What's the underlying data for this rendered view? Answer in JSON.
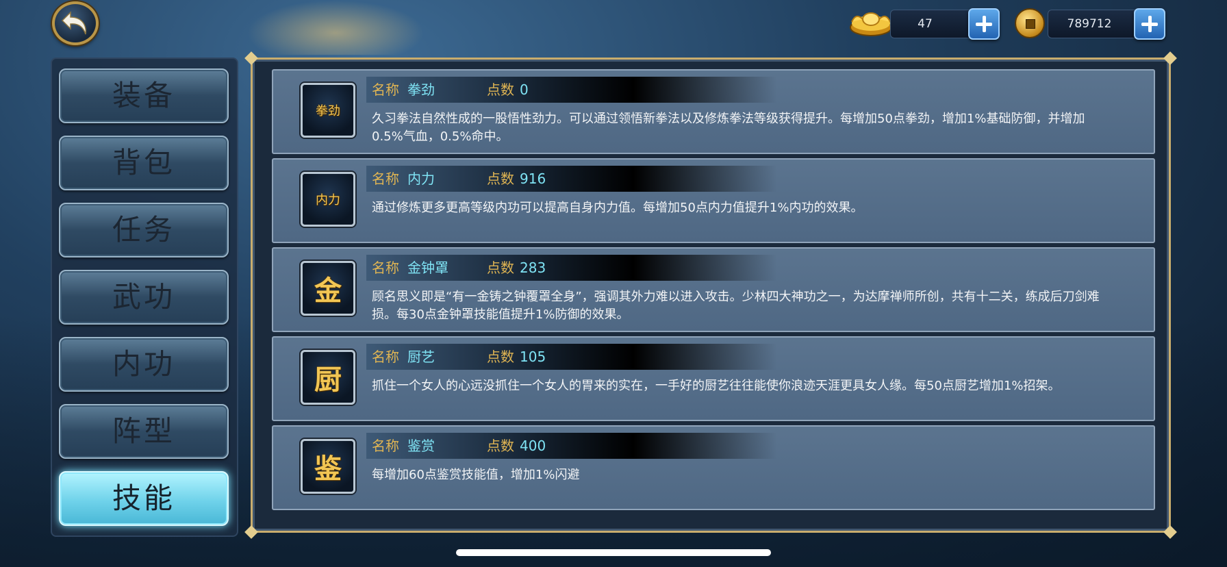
{
  "currency": {
    "ingot": {
      "icon": "gold-ingot-icon",
      "value": "47"
    },
    "coin": {
      "icon": "copper-coin-icon",
      "value": "789712"
    }
  },
  "menu": {
    "items": [
      {
        "label": "装备",
        "active": false
      },
      {
        "label": "背包",
        "active": false
      },
      {
        "label": "任务",
        "active": false
      },
      {
        "label": "武功",
        "active": false
      },
      {
        "label": "内功",
        "active": false
      },
      {
        "label": "阵型",
        "active": false
      },
      {
        "label": "技能",
        "active": true
      }
    ]
  },
  "skills": {
    "name_label": "名称",
    "points_label": "点数",
    "items": [
      {
        "icon_text": "拳劲",
        "name": "拳劲",
        "points": "0",
        "desc": "久习拳法自然性成的一股悟性劲力。可以通过领悟新拳法以及修炼拳法等级获得提升。每增加50点拳劲，增加1%基础防御，并增加0.5%气血，0.5%命中。"
      },
      {
        "icon_text": "内力",
        "name": "内力",
        "points": "916",
        "desc": "通过修炼更多更高等级内功可以提高自身内力值。每增加50点内力值提升1%内功的效果。"
      },
      {
        "icon_text": "金",
        "name": "金钟罩",
        "points": "283",
        "desc": "顾名思义即是“有一金铸之钟覆罩全身”，强调其外力难以进入攻击。少林四大神功之一，为达摩禅师所创，共有十二关，练成后刀剑难损。每30点金钟罩技能值提升1%防御的效果。"
      },
      {
        "icon_text": "厨",
        "name": "厨艺",
        "points": "105",
        "desc": "抓住一个女人的心远没抓住一个女人的胃来的实在，一手好的厨艺往往能使你浪迹天涯更具女人缘。每50点厨艺增加1%招架。"
      },
      {
        "icon_text": "鉴",
        "name": "鉴赏",
        "points": "400",
        "desc": "每增加60点鉴赏技能值，增加1%闪避"
      }
    ]
  }
}
